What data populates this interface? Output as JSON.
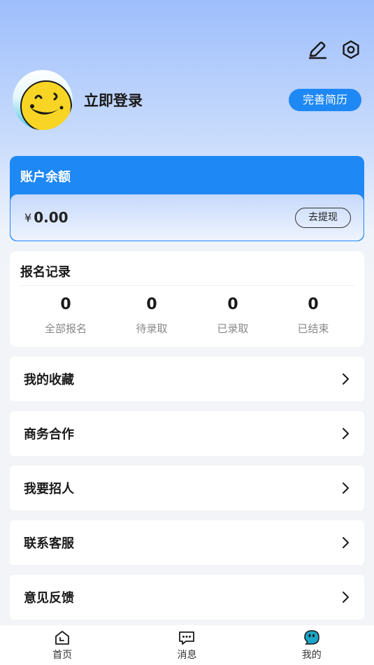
{
  "header": {
    "edit_icon": "pencil-icon",
    "settings_icon": "hexagon-gear-icon"
  },
  "profile": {
    "login_text": "立即登录",
    "resume_button": "完善简历"
  },
  "balance": {
    "title": "账户余额",
    "currency": "¥",
    "amount": "0.00",
    "withdraw_button": "去提现"
  },
  "records": {
    "title": "报名记录",
    "stats": [
      {
        "value": "0",
        "label": "全部报名"
      },
      {
        "value": "0",
        "label": "待录取"
      },
      {
        "value": "0",
        "label": "已录取"
      },
      {
        "value": "0",
        "label": "已结束"
      }
    ]
  },
  "menu": [
    {
      "label": "我的收藏"
    },
    {
      "label": "商务合作"
    },
    {
      "label": "我要招人"
    },
    {
      "label": "联系客服"
    },
    {
      "label": "意见反馈"
    }
  ],
  "tabbar": [
    {
      "label": "首页",
      "icon": "home-icon"
    },
    {
      "label": "消息",
      "icon": "message-icon"
    },
    {
      "label": "我的",
      "icon": "mine-icon",
      "active": true
    }
  ],
  "colors": {
    "accent": "#1e88f5",
    "active_tab_icon": "#1aa6c8"
  }
}
